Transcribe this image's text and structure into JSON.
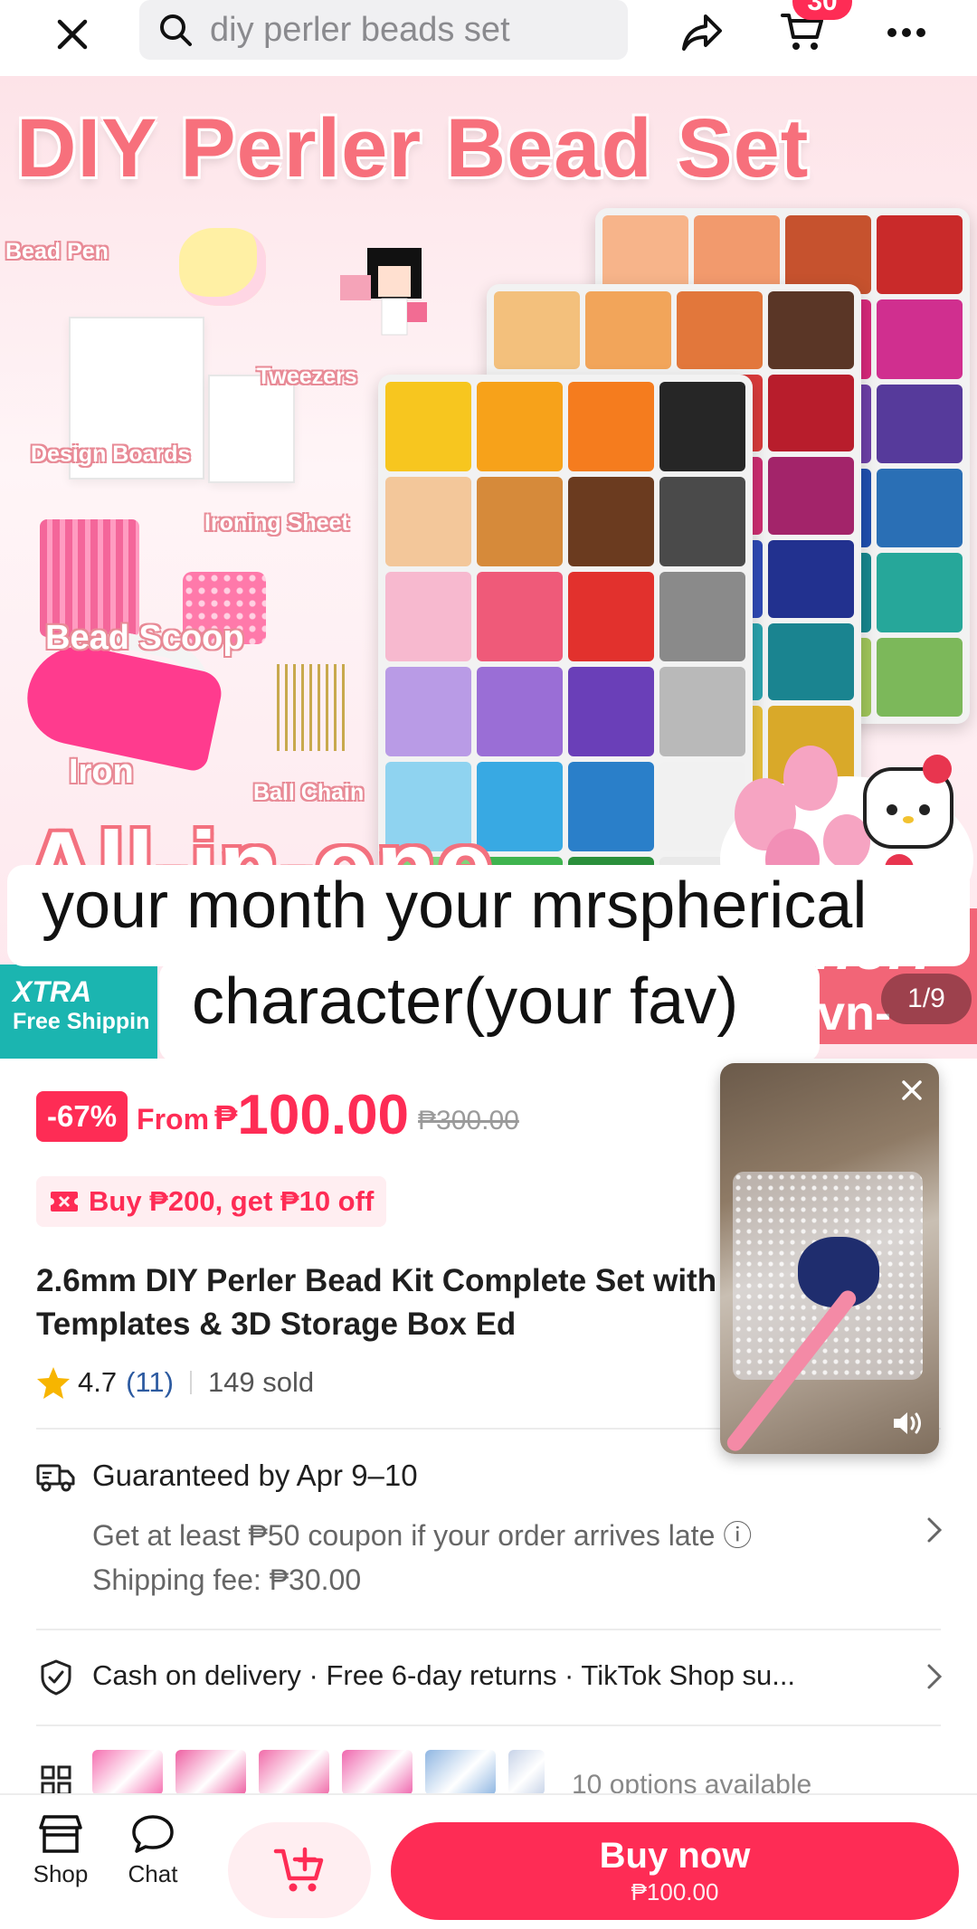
{
  "top_bar": {
    "search_text": "diy perler beads set",
    "cart_count": "30"
  },
  "hero": {
    "title": "DIY Perler Bead Set",
    "accessory_labels": [
      "Bead Pen",
      "Tweezers",
      "Design Boards",
      "Ironing Sheet",
      "Bead Scoop",
      "Iron",
      "Ball Chain"
    ],
    "slogan": "All-in-one",
    "right_banner_top": "ner!",
    "right_banner_bottom": "vn-ups",
    "badge_title": "XTRA",
    "badge_subtitle": "Free Shippin",
    "image_counter": "1/9",
    "caption_line1": "your month your mrspherical",
    "caption_line2": "character(your fav)"
  },
  "price": {
    "discount": "-67%",
    "from_label": "From",
    "currency": "₱",
    "value": "100.00",
    "original": "₱300.00"
  },
  "promo": {
    "label": "Buy ₱200, get ₱10 off"
  },
  "product": {
    "title": "2.6mm DIY Perler Bead Kit Complete Set with Tweezers Templates & 3D Storage Box Ed",
    "rating": "4.7",
    "rating_count": "(11)",
    "sold": "149 sold"
  },
  "shipping": {
    "guarantee": "Guaranteed by Apr 9–10",
    "coupon": "Get at least ₱50 coupon if your order arrives late ⓘ",
    "fee": "Shipping fee: ₱30.00"
  },
  "services": {
    "text": "Cash on delivery · Free 6-day returns · TikTok Shop su..."
  },
  "variants": {
    "text": "10 options available",
    "thumb_colors": [
      "#f56fb0",
      "#ee5fa2",
      "#f06aa8",
      "#ef66ad",
      "#8fb6e2",
      "#c7d3e8"
    ]
  },
  "bottom_bar": {
    "shop_label": "Shop",
    "chat_label": "Chat",
    "buy_label": "Buy now",
    "buy_price": "₱100.00"
  },
  "colors": {
    "accent": "#fe2c55",
    "accent_light": "#ffeef1",
    "teal": "#1bb5b0"
  },
  "icons": [
    "close-icon",
    "search-icon",
    "share-icon",
    "cart-icon",
    "more-icon",
    "coupon-icon",
    "star-icon",
    "truck-icon",
    "shield-check-icon",
    "grid-icon",
    "chevron-right-icon",
    "shop-icon",
    "chat-icon",
    "add-to-cart-icon",
    "sound-icon"
  ]
}
